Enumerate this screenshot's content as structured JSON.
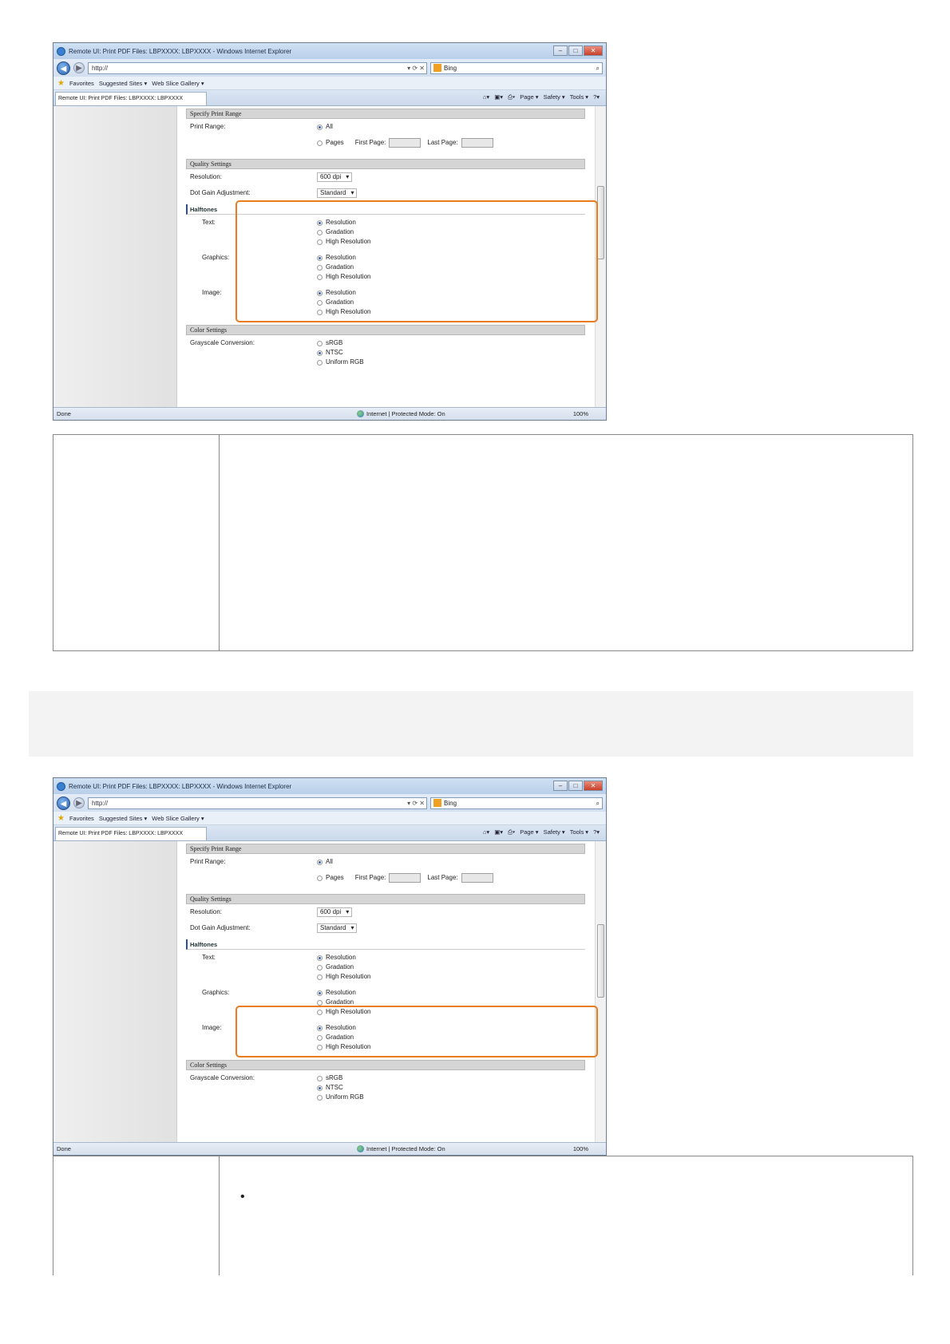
{
  "screenshots": [
    {
      "window_title": "Remote UI: Print PDF Files: LBPXXXX: LBPXXXX - Windows Internet Explorer",
      "address": "http://",
      "search_text": "Bing",
      "favorites": {
        "label": "Favorites",
        "suggested": "Suggested Sites ▾",
        "slice": "Web Slice Gallery ▾"
      },
      "tab_title": "Remote UI: Print PDF Files: LBPXXXX: LBPXXXX",
      "cmd": {
        "page": "Page ▾",
        "safety": "Safety ▾",
        "tools": "Tools ▾",
        "help": "?▾"
      },
      "status": {
        "left": "Done",
        "zone": "Internet | Protected Mode: On",
        "zoom": "100%"
      },
      "highlight": "halftones"
    },
    {
      "window_title": "Remote UI: Print PDF Files: LBPXXXX: LBPXXXX - Windows Internet Explorer",
      "address": "http://",
      "search_text": "Bing",
      "favorites": {
        "label": "Favorites",
        "suggested": "Suggested Sites ▾",
        "slice": "Web Slice Gallery ▾"
      },
      "tab_title": "Remote UI: Print PDF Files: LBPXXXX: LBPXXXX",
      "cmd": {
        "page": "Page ▾",
        "safety": "Safety ▾",
        "tools": "Tools ▾",
        "help": "?▾"
      },
      "status": {
        "left": "Done",
        "zone": "Internet | Protected Mode: On",
        "zoom": "100%"
      },
      "highlight": "color-settings"
    }
  ],
  "form": {
    "print_range": {
      "header": "Specify Print Range",
      "label": "Print Range:",
      "all": "All",
      "pages": "Pages",
      "first": "First Page:",
      "last": "Last Page:"
    },
    "quality": {
      "header": "Quality Settings",
      "res_label": "Resolution:",
      "res_value": "600 dpi",
      "dot_label": "Dot Gain Adjustment:",
      "dot_value": "Standard"
    },
    "halftones": {
      "header": "Halftones",
      "groups": [
        {
          "label": "Text:",
          "selected": 0
        },
        {
          "label": "Graphics:",
          "selected": 0
        },
        {
          "label": "Image:",
          "selected": 0
        }
      ],
      "options": [
        "Resolution",
        "Gradation",
        "High Resolution"
      ]
    },
    "color": {
      "header": "Color Settings",
      "label": "Grayscale Conversion:",
      "options": [
        "sRGB",
        "NTSC",
        "Uniform RGB"
      ],
      "selected": 1
    }
  },
  "colors": {
    "highlight": "#e87c1e",
    "radio_selected": "#3a5fb0"
  }
}
